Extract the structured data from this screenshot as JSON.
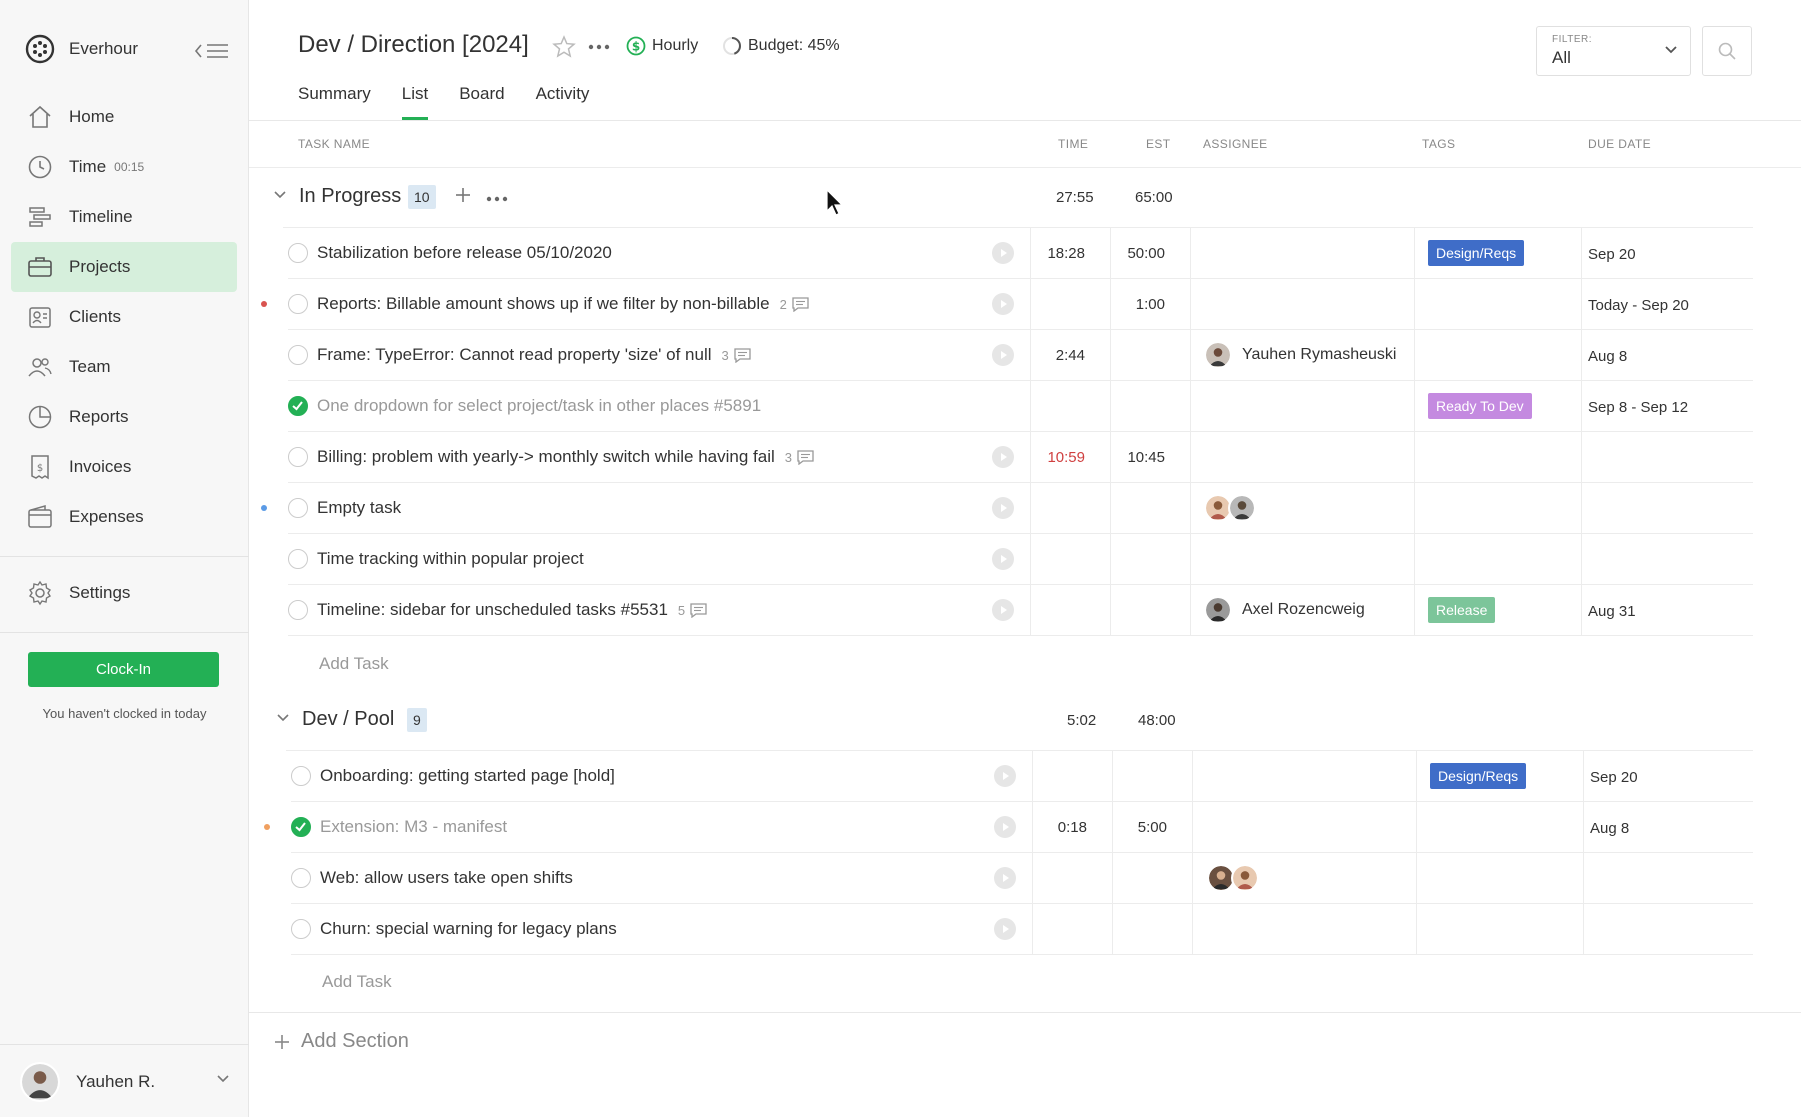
{
  "app": {
    "name": "Everhour"
  },
  "sidebar": {
    "items": [
      {
        "label": "Home",
        "icon": "home-icon"
      },
      {
        "label": "Time",
        "icon": "clock-icon",
        "sub": "00:15"
      },
      {
        "label": "Timeline",
        "icon": "timeline-icon"
      },
      {
        "label": "Projects",
        "icon": "briefcase-icon",
        "active": true
      },
      {
        "label": "Clients",
        "icon": "clients-icon"
      },
      {
        "label": "Team",
        "icon": "team-icon"
      },
      {
        "label": "Reports",
        "icon": "pie-chart-icon"
      },
      {
        "label": "Invoices",
        "icon": "invoice-icon"
      },
      {
        "label": "Expenses",
        "icon": "wallet-icon"
      }
    ],
    "settings_label": "Settings",
    "clock_in_label": "Clock-In",
    "clock_note": "You haven't clocked in today",
    "user_name": "Yauhen R."
  },
  "header": {
    "title": "Dev / Direction [2024]",
    "billing": "Hourly",
    "budget": "Budget: 45%",
    "budget_fraction": 0.45,
    "filter_label": "FILTER:",
    "filter_value": "All",
    "tabs": [
      {
        "label": "Summary"
      },
      {
        "label": "List",
        "active": true
      },
      {
        "label": "Board"
      },
      {
        "label": "Activity"
      }
    ]
  },
  "columns": {
    "task_name": "TASK NAME",
    "time": "TIME",
    "est": "EST",
    "assignee": "ASSIGNEE",
    "tags": "TAGS",
    "due_date": "DUE DATE"
  },
  "colors": {
    "accent_green": "#23b055",
    "tag_design": "#3f6dc8",
    "tag_ready": "#c48ae0",
    "tag_release": "#7cc59a",
    "dot_red": "#d9534f",
    "dot_blue": "#5b9be6",
    "dot_orange": "#f0a060"
  },
  "sections": [
    {
      "title": "In Progress",
      "count": "10",
      "time": "27:55",
      "est": "65:00",
      "add_task": "Add Task",
      "tasks": [
        {
          "name": "Stabilization before release 05/10/2020",
          "time": "18:28",
          "est": "50:00",
          "tag": "Design/Reqs",
          "due": "Sep 20"
        },
        {
          "name": "Reports: Billable amount shows up if we filter by non-billable",
          "comments": "2",
          "est": "1:00",
          "due": "Today - Sep 20"
        },
        {
          "name": "Frame: TypeError: Cannot read property 'size' of null",
          "comments": "3",
          "time": "2:44",
          "assignee": "Yauhen Rymasheuski",
          "due": "Aug 8"
        },
        {
          "name": "One dropdown for select project/task in other places #5891",
          "done": true,
          "tag": "Ready To Dev",
          "due": "Sep 8 - Sep 12"
        },
        {
          "name": "Billing: problem with yearly-> monthly switch while having fail",
          "comments": "3",
          "time": "10:59",
          "est": "10:45"
        },
        {
          "name": "Empty task"
        },
        {
          "name": "Time tracking within popular project"
        },
        {
          "name": "Timeline: sidebar for unscheduled tasks #5531",
          "comments": "5",
          "assignee": "Axel Rozencweig",
          "tag": "Release",
          "due": "Aug 31"
        }
      ]
    },
    {
      "title": "Dev / Pool",
      "count": "9",
      "time": "5:02",
      "est": "48:00",
      "add_task": "Add Task",
      "tasks": [
        {
          "name": "Onboarding: getting started page [hold]",
          "tag": "Design/Reqs",
          "due": "Sep 20"
        },
        {
          "name": "Extension: M3 - manifest",
          "done": true,
          "time": "0:18",
          "est": "5:00",
          "due": "Aug 8"
        },
        {
          "name": "Web: allow users take open shifts"
        },
        {
          "name": "Churn: special warning for legacy plans"
        }
      ]
    }
  ],
  "add_section": "Add Section"
}
